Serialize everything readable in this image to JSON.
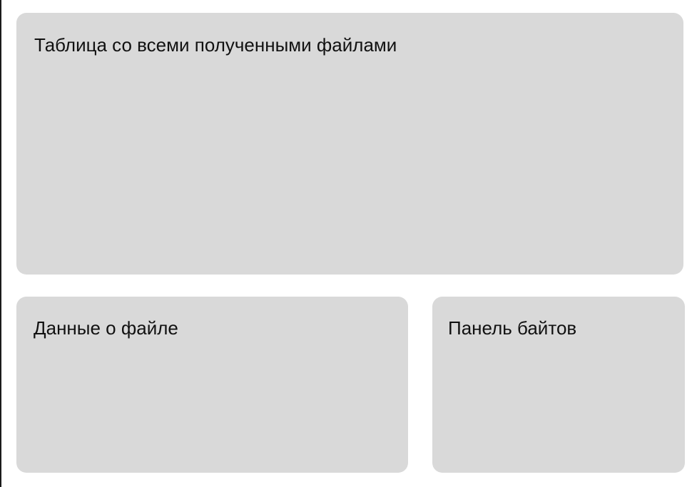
{
  "panels": {
    "files_table": {
      "title": "Таблица со всеми полученными файлами"
    },
    "file_details": {
      "title": "Данные о файле"
    },
    "bytes": {
      "title": "Панель байтов"
    }
  },
  "colors": {
    "background": "#ffffff",
    "panel": "#d9d9d9",
    "text": "#111111",
    "border": "#1a1a1a"
  }
}
